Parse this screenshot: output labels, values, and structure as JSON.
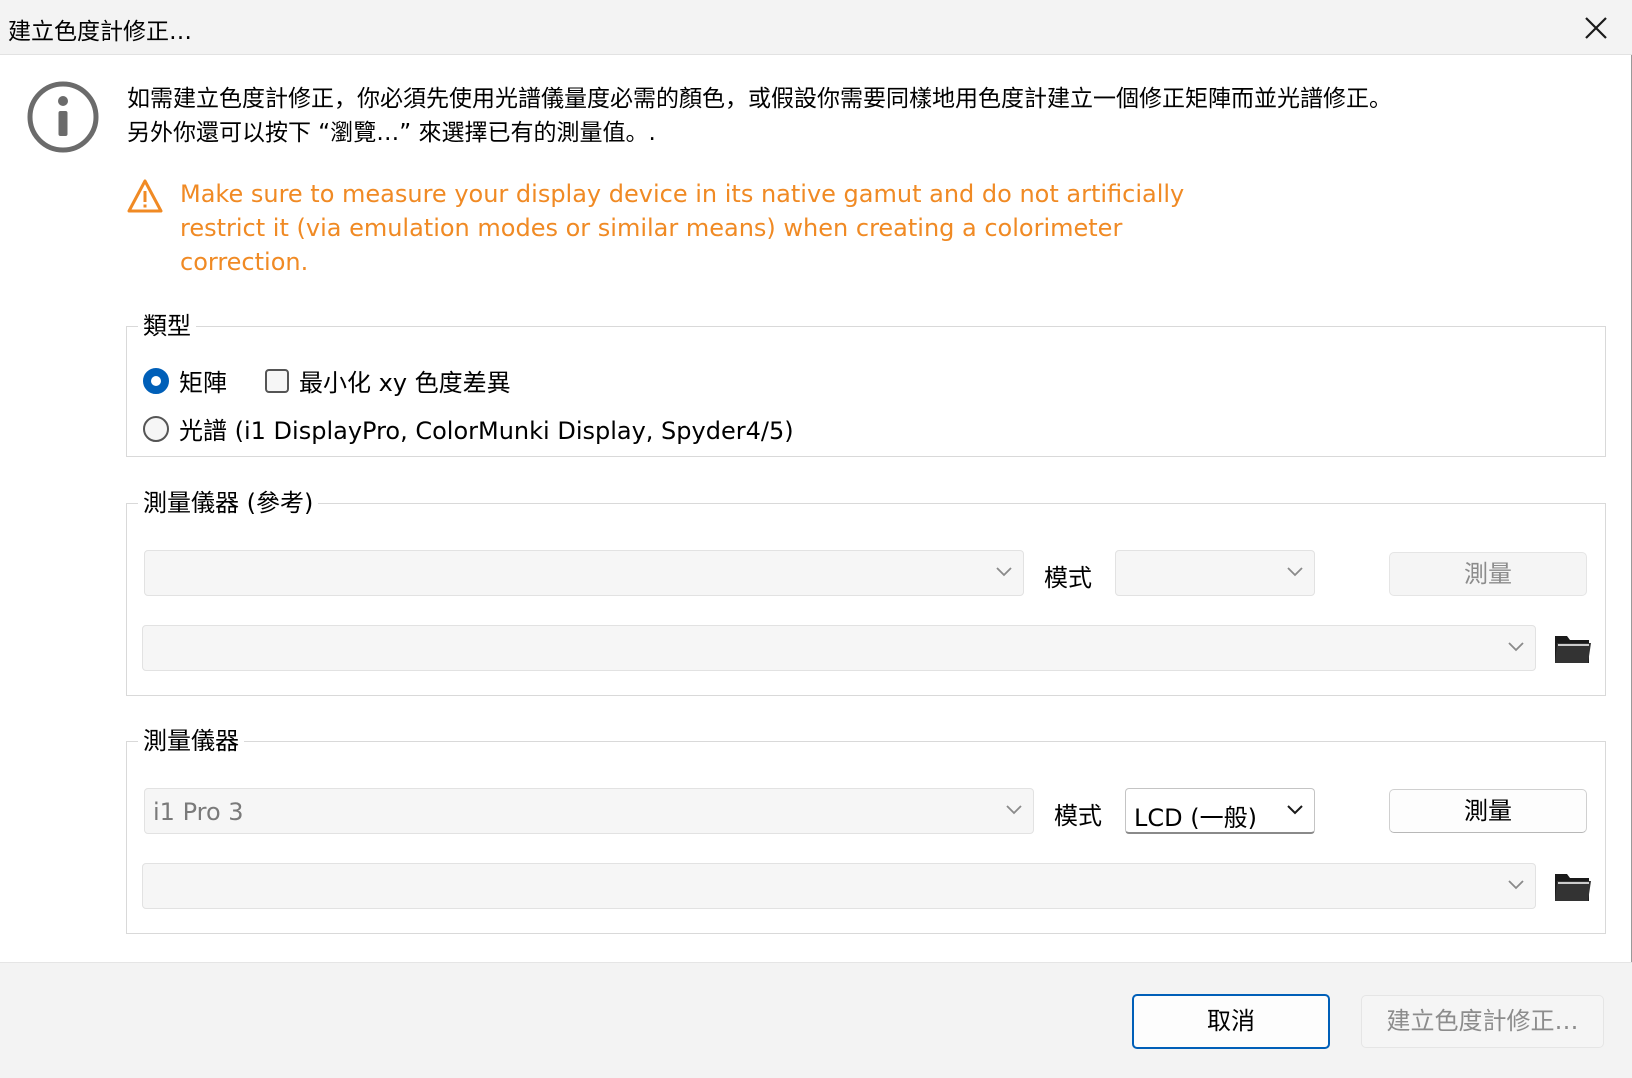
{
  "window": {
    "title": "建立色度計修正…"
  },
  "info": {
    "line1": "如需建立色度計修正，你必須先使用光譜儀量度必需的顏色，或假設你需要同樣地用色度計建立一個修正矩陣而並光譜修正。",
    "line2": "另外你還可以按下 “瀏覽…” 來選擇已有的測量值。."
  },
  "warning": {
    "text": "Make sure to measure your display device in its native gamut and do not artificially restrict it (via emulation modes or similar means) when creating a colorimeter correction.",
    "color": "#f08a24"
  },
  "type_group": {
    "label": "類型",
    "matrix_label": "矩陣",
    "matrix_selected": true,
    "minimize_xy_label": "最小化 xy 色度差異",
    "minimize_xy_checked": false,
    "spectral_label": "光譜 (i1 DisplayPro, ColorMunki Display, Spyder4/5)",
    "spectral_selected": false
  },
  "reference_group": {
    "label": "測量儀器 (參考)",
    "instrument_value": "",
    "mode_label": "模式",
    "mode_value": "",
    "measure_label": "測量",
    "measure_enabled": false,
    "file_value": ""
  },
  "instrument_group": {
    "label": "測量儀器",
    "instrument_value": "i1 Pro 3",
    "mode_label": "模式",
    "mode_value": "LCD (一般)",
    "measure_label": "測量",
    "measure_enabled": true,
    "file_value": ""
  },
  "footer": {
    "cancel_label": "取消",
    "create_label": "建立色度計修正…",
    "create_enabled": false
  },
  "colors": {
    "accent": "#005fb8",
    "warning": "#f08a24"
  }
}
